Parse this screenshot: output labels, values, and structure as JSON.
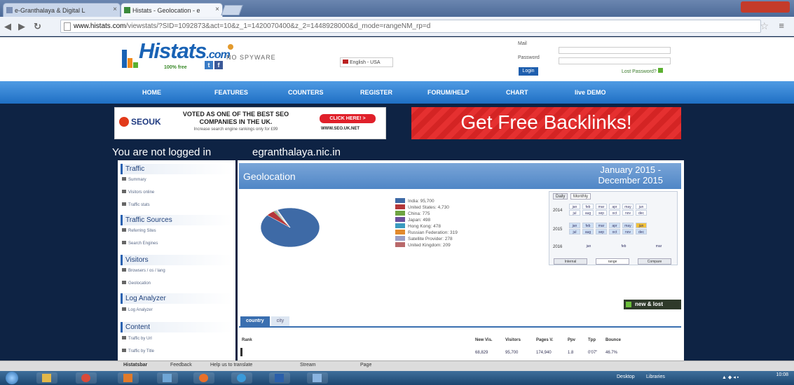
{
  "browser": {
    "tabs": [
      {
        "label": "e-Granthalaya & Digital L"
      },
      {
        "label": "Histats - Geolocation - e"
      }
    ],
    "url_host": "www.histats.com",
    "url_path": "/viewstats/?SID=1092873&act=10&z_1=1420070400&z_2=1448928000&d_mode=rangeNM_rp=d"
  },
  "site": {
    "logo_text": "Histats",
    "logo_suffix": ".com",
    "logo_tagline": "100% free",
    "nospyware": "NO SPYWARE",
    "language": "English - USA",
    "login_mail_label": "Mail",
    "login_password_label": "Password",
    "login_button": "Login",
    "lost_password": "Lost Password?"
  },
  "nav": [
    "HOME",
    "FEATURES",
    "COUNTERS",
    "REGISTER",
    "FORUM/HELP",
    "CHART",
    "live DEMO"
  ],
  "banner1": {
    "logo": "SEOUK",
    "headline1": "VOTED AS ONE OF THE BEST SEO",
    "headline2": "COMPANIES IN THE UK.",
    "sub": "Increase search engine rankings only for £99",
    "cta": "CLICK HERE! >",
    "url": "WWW.SEO.UK.NET"
  },
  "banner2": {
    "text": "Get Free Backlinks!"
  },
  "status": {
    "not_logged": "You are not logged in",
    "site_name": "egranthalaya.nic.in"
  },
  "sidebar": {
    "traffic": "Traffic",
    "traffic_items": [
      "Summary",
      "Visitors online",
      "Traffic stats"
    ],
    "sources": "Traffic Sources",
    "sources_items": [
      "Referring Sites",
      "Search Engines"
    ],
    "visitors": "Visitors",
    "visitors_items": [
      "Browsers / os / lang",
      "Geolocation"
    ],
    "log": "Log Analyzer",
    "log_items": [
      "Log Analyzer"
    ],
    "content": "Content",
    "content_items": [
      "Traffic by Url",
      "Traffic by Title"
    ]
  },
  "panel": {
    "title": "Geolocation",
    "date_line1": "January 2015 -",
    "date_line2": "December 2015",
    "new_lost": "new & lost",
    "tab_country": "country",
    "tab_city": "city"
  },
  "calendar": {
    "tabs": [
      "Daily",
      "Monthly"
    ],
    "years": [
      "2014",
      "2015",
      "2016"
    ],
    "months_row1": [
      "jan",
      "feb",
      "mar",
      "apr",
      "may",
      "jun"
    ],
    "months_row2": [
      "jul",
      "aug",
      "sep",
      "oct",
      "nov",
      "dec"
    ],
    "buttons": [
      "Internal",
      "range",
      "Compare"
    ]
  },
  "chart_data": {
    "type": "pie",
    "categories": [
      "India",
      "United States",
      "China",
      "Japan",
      "Hong Kong",
      "Russian Federation",
      "Satellite Provider",
      "United Kingdom"
    ],
    "values": [
      95700,
      4730,
      775,
      498,
      478,
      319,
      278,
      209
    ],
    "colors": [
      "#3e6aa6",
      "#b4373a",
      "#6ea342",
      "#6b4e9b",
      "#3a9bbf",
      "#e28a2c",
      "#9a9fc6",
      "#b8686a"
    ],
    "legend_labels": [
      "India: 95,700",
      "United States: 4,730",
      "China: 775",
      "Japan: 498",
      "Hong Kong: 478",
      "Russian Federation: 319",
      "Satellite Provider: 278",
      "United Kingdom: 209"
    ]
  },
  "table": {
    "headers": [
      "Rank",
      "New Vis.",
      "Visitors",
      "Pages V.",
      "Ppv",
      "Tpp",
      "Bounce"
    ],
    "row1": [
      "68,829",
      "95,700",
      "174,940",
      "1.8",
      "0'07\"",
      "46.7%"
    ]
  },
  "histbar": [
    "Histatsbar",
    "Feedback",
    "Help us to translate",
    "Stream",
    "Page"
  ],
  "taskbar": {
    "desktop": "Desktop",
    "libraries": "Libraries",
    "time": "10:08"
  }
}
